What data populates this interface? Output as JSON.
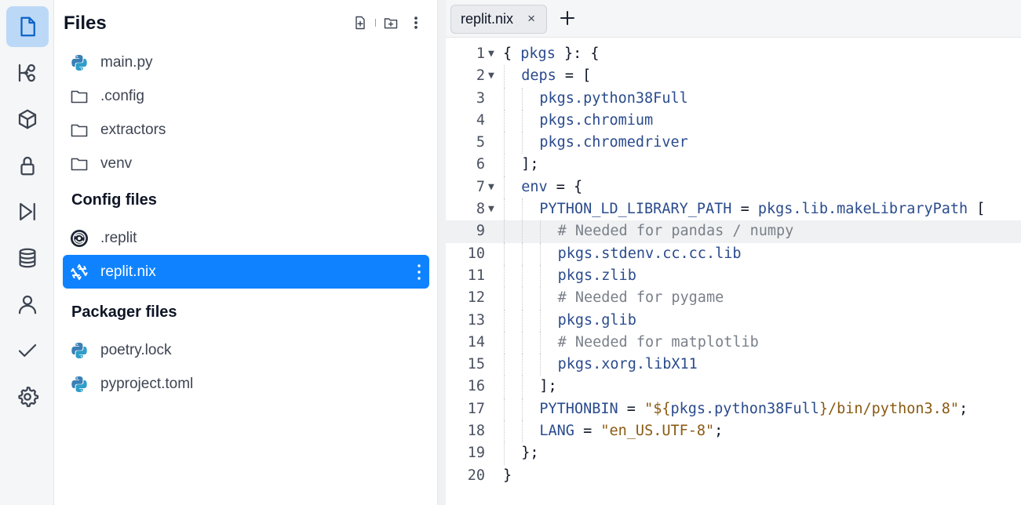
{
  "files_panel": {
    "title": "Files",
    "items": [
      {
        "label": "main.py",
        "icon": "python-icon"
      },
      {
        "label": ".config",
        "icon": "folder-icon"
      },
      {
        "label": "extractors",
        "icon": "folder-icon"
      },
      {
        "label": "venv",
        "icon": "folder-icon"
      }
    ],
    "config_section": "Config files",
    "config_items": [
      {
        "label": ".replit",
        "icon": "replit-config-icon"
      },
      {
        "label": "replit.nix",
        "icon": "nix-icon",
        "selected": true
      }
    ],
    "packager_section": "Packager files",
    "packager_items": [
      {
        "label": "poetry.lock",
        "icon": "python-icon"
      },
      {
        "label": "pyproject.toml",
        "icon": "python-icon"
      }
    ]
  },
  "activity_bar": [
    "files-icon",
    "git-branch-icon",
    "packages-cube-icon",
    "secrets-lock-icon",
    "run-icon",
    "database-icon",
    "user-icon",
    "check-icon",
    "settings-gear-icon"
  ],
  "editor": {
    "tab_label": "replit.nix",
    "tab_close": "×",
    "highlighted_line": 9,
    "lines": [
      {
        "n": "1",
        "fold": true,
        "indent": 0,
        "tokens": [
          [
            "p",
            "{ "
          ],
          [
            "id",
            "pkgs"
          ],
          [
            "p",
            " }: {"
          ]
        ]
      },
      {
        "n": "2",
        "fold": true,
        "indent": 1,
        "tokens": [
          [
            "id",
            "deps"
          ],
          [
            "p",
            " = ["
          ]
        ]
      },
      {
        "n": "3",
        "fold": false,
        "indent": 2,
        "tokens": [
          [
            "id",
            "pkgs.python38Full"
          ]
        ]
      },
      {
        "n": "4",
        "fold": false,
        "indent": 2,
        "tokens": [
          [
            "id",
            "pkgs.chromium"
          ]
        ]
      },
      {
        "n": "5",
        "fold": false,
        "indent": 2,
        "tokens": [
          [
            "id",
            "pkgs.chromedriver"
          ]
        ]
      },
      {
        "n": "6",
        "fold": false,
        "indent": 1,
        "tokens": [
          [
            "p",
            "];"
          ]
        ]
      },
      {
        "n": "7",
        "fold": true,
        "indent": 1,
        "tokens": [
          [
            "id",
            "env"
          ],
          [
            "p",
            " = {"
          ]
        ]
      },
      {
        "n": "8",
        "fold": true,
        "indent": 2,
        "tokens": [
          [
            "id",
            "PYTHON_LD_LIBRARY_PATH"
          ],
          [
            "p",
            " = "
          ],
          [
            "id",
            "pkgs.lib.makeLibraryPath"
          ],
          [
            "p",
            " ["
          ]
        ]
      },
      {
        "n": "9",
        "fold": false,
        "indent": 3,
        "tokens": [
          [
            "c",
            "# Needed for pandas / numpy"
          ]
        ]
      },
      {
        "n": "10",
        "fold": false,
        "indent": 3,
        "tokens": [
          [
            "id",
            "pkgs.stdenv.cc.cc.lib"
          ]
        ]
      },
      {
        "n": "11",
        "fold": false,
        "indent": 3,
        "tokens": [
          [
            "id",
            "pkgs.zlib"
          ]
        ]
      },
      {
        "n": "12",
        "fold": false,
        "indent": 3,
        "tokens": [
          [
            "c",
            "# Needed for pygame"
          ]
        ]
      },
      {
        "n": "13",
        "fold": false,
        "indent": 3,
        "tokens": [
          [
            "id",
            "pkgs.glib"
          ]
        ]
      },
      {
        "n": "14",
        "fold": false,
        "indent": 3,
        "tokens": [
          [
            "c",
            "# Needed for matplotlib"
          ]
        ]
      },
      {
        "n": "15",
        "fold": false,
        "indent": 3,
        "tokens": [
          [
            "id",
            "pkgs.xorg.libX11"
          ]
        ]
      },
      {
        "n": "16",
        "fold": false,
        "indent": 2,
        "tokens": [
          [
            "p",
            "];"
          ]
        ]
      },
      {
        "n": "17",
        "fold": false,
        "indent": 2,
        "tokens": [
          [
            "id",
            "PYTHONBIN"
          ],
          [
            "p",
            " = "
          ],
          [
            "s",
            "\"${"
          ],
          [
            "id",
            "pkgs.python38Full"
          ],
          [
            "s",
            "}/bin/python3.8\""
          ],
          [
            "p",
            ";"
          ]
        ]
      },
      {
        "n": "18",
        "fold": false,
        "indent": 2,
        "tokens": [
          [
            "id",
            "LANG"
          ],
          [
            "p",
            " = "
          ],
          [
            "s",
            "\"en_US.UTF-8\""
          ],
          [
            "p",
            ";"
          ]
        ]
      },
      {
        "n": "19",
        "fold": false,
        "indent": 1,
        "tokens": [
          [
            "p",
            "};"
          ]
        ]
      },
      {
        "n": "20",
        "fold": false,
        "indent": 0,
        "tokens": [
          [
            "p",
            "}"
          ]
        ]
      }
    ]
  }
}
